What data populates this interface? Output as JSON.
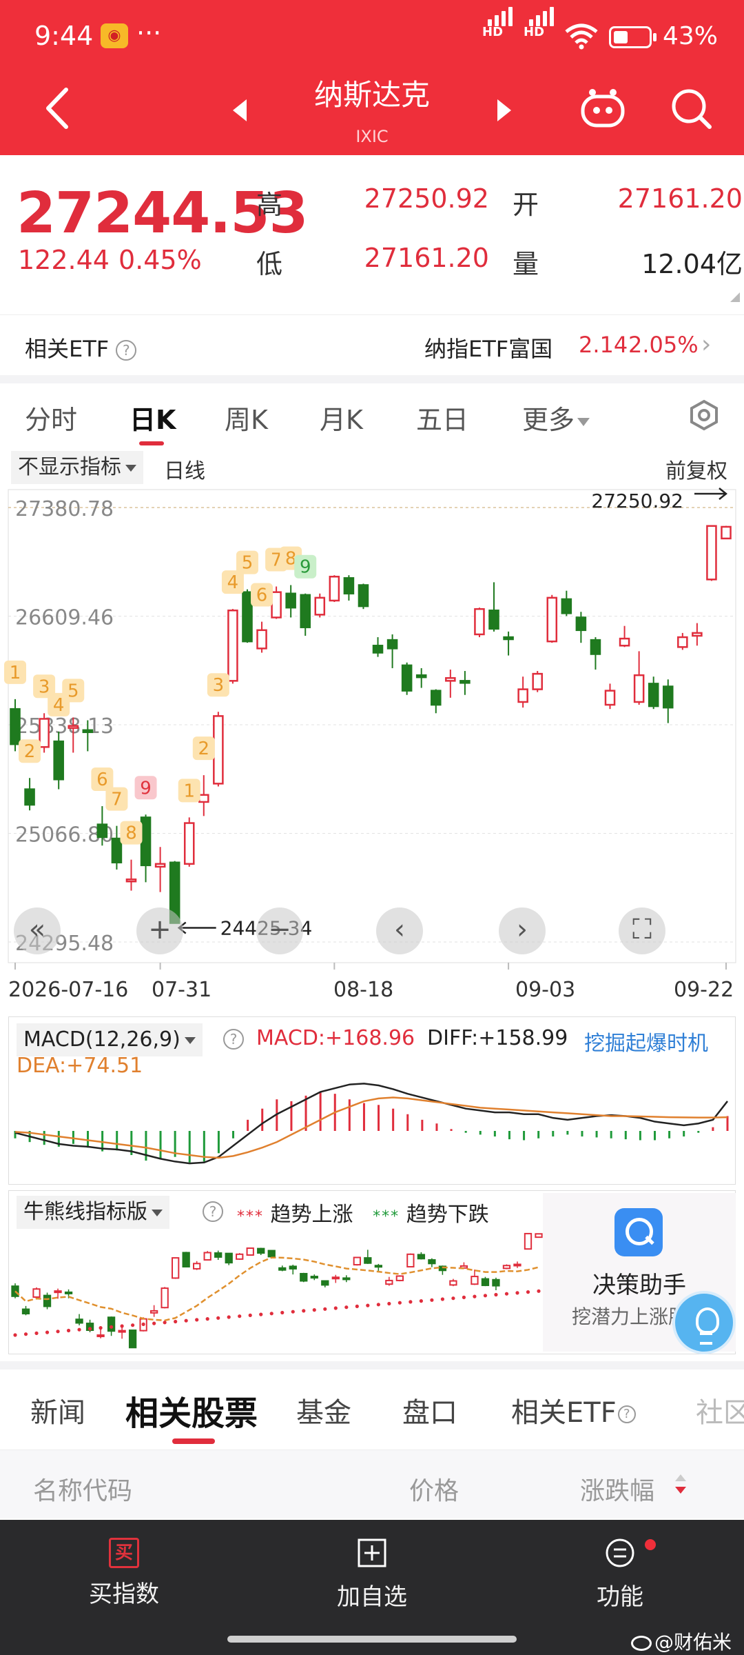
{
  "status": {
    "time": "9:44",
    "signal1": "HD",
    "signal2": "HD",
    "battery": "43%"
  },
  "nav": {
    "title": "纳斯达克",
    "subtitle": "IXIC"
  },
  "quote": {
    "price": "27244.53",
    "change": "122.44",
    "change_pct": "0.45%",
    "high_label": "高",
    "high": "27250.92",
    "open_label": "开",
    "open": "27161.20",
    "low_label": "低",
    "low": "27161.20",
    "volume_label": "量",
    "volume": "12.04亿"
  },
  "etf": {
    "label": "相关ETF",
    "name": "纳指ETF富国",
    "value": "2.14",
    "pct": "2.05%"
  },
  "period_tabs": [
    "分时",
    "日K",
    "周K",
    "月K",
    "五日",
    "更多"
  ],
  "toolbar": {
    "indicator_select": "不显示指标",
    "line_type": "日线",
    "adjust": "前复权"
  },
  "chart_data": {
    "type": "candlestick",
    "title": "",
    "y_ticks": [
      "27380.78",
      "26609.46",
      "25838.13",
      "25066.80",
      "24295.48"
    ],
    "x_ticks": [
      "2026-07-16",
      "07-31",
      "08-18",
      "09-03",
      "09-22"
    ],
    "max_marker": "27250.92",
    "min_marker": "24425.34",
    "candles": [
      {
        "o": 25950,
        "c": 25700,
        "h": 26020,
        "l": 25650
      },
      {
        "o": 25380,
        "c": 25270,
        "h": 25460,
        "l": 25230
      },
      {
        "o": 25680,
        "c": 25880,
        "h": 25920,
        "l": 25640
      },
      {
        "o": 25720,
        "c": 25450,
        "h": 25790,
        "l": 25380
      },
      {
        "o": 25830,
        "c": 25830,
        "h": 25890,
        "l": 25640
      },
      {
        "o": 25800,
        "c": 25790,
        "h": 25870,
        "l": 25650
      },
      {
        "o": 25130,
        "c": 25040,
        "h": 25260,
        "l": 24980
      },
      {
        "o": 25030,
        "c": 24860,
        "h": 25120,
        "l": 24810
      },
      {
        "o": 24740,
        "c": 24740,
        "h": 24880,
        "l": 24660
      },
      {
        "o": 25180,
        "c": 24840,
        "h": 25200,
        "l": 24720
      },
      {
        "o": 24830,
        "c": 24850,
        "h": 24970,
        "l": 24650
      },
      {
        "o": 24860,
        "c": 24430,
        "h": 24870,
        "l": 24425
      },
      {
        "o": 24850,
        "c": 25140,
        "h": 25180,
        "l": 24830
      },
      {
        "o": 25290,
        "c": 25340,
        "h": 25480,
        "l": 25190
      },
      {
        "o": 25420,
        "c": 25900,
        "h": 25930,
        "l": 25400
      },
      {
        "o": 26150,
        "c": 26650,
        "h": 26660,
        "l": 26130
      },
      {
        "o": 26780,
        "c": 26430,
        "h": 26800,
        "l": 26420
      },
      {
        "o": 26380,
        "c": 26510,
        "h": 26570,
        "l": 26350
      },
      {
        "o": 26600,
        "c": 26780,
        "h": 26820,
        "l": 26590
      },
      {
        "o": 26770,
        "c": 26670,
        "h": 26830,
        "l": 26600
      },
      {
        "o": 26760,
        "c": 26530,
        "h": 26770,
        "l": 26470
      },
      {
        "o": 26620,
        "c": 26740,
        "h": 26770,
        "l": 26600
      },
      {
        "o": 26720,
        "c": 26890,
        "h": 26900,
        "l": 26710
      },
      {
        "o": 26880,
        "c": 26770,
        "h": 26900,
        "l": 26720
      },
      {
        "o": 26830,
        "c": 26680,
        "h": 26840,
        "l": 26660
      },
      {
        "o": 26400,
        "c": 26350,
        "h": 26460,
        "l": 26320
      },
      {
        "o": 26440,
        "c": 26380,
        "h": 26480,
        "l": 26240
      },
      {
        "o": 26260,
        "c": 26080,
        "h": 26280,
        "l": 26050
      },
      {
        "o": 26190,
        "c": 26180,
        "h": 26240,
        "l": 26100
      },
      {
        "o": 26080,
        "c": 25980,
        "h": 26090,
        "l": 25920
      },
      {
        "o": 26150,
        "c": 26170,
        "h": 26230,
        "l": 26030
      },
      {
        "o": 26150,
        "c": 26140,
        "h": 26220,
        "l": 26050
      },
      {
        "o": 26480,
        "c": 26660,
        "h": 26670,
        "l": 26460
      },
      {
        "o": 26650,
        "c": 26520,
        "h": 26850,
        "l": 26500
      },
      {
        "o": 26460,
        "c": 26450,
        "h": 26500,
        "l": 26330
      },
      {
        "o": 26000,
        "c": 26090,
        "h": 26180,
        "l": 25960
      },
      {
        "o": 26090,
        "c": 26200,
        "h": 26220,
        "l": 26070
      },
      {
        "o": 26430,
        "c": 26740,
        "h": 26760,
        "l": 26420
      },
      {
        "o": 26730,
        "c": 26630,
        "h": 26790,
        "l": 26610
      },
      {
        "o": 26600,
        "c": 26510,
        "h": 26640,
        "l": 26420
      },
      {
        "o": 26440,
        "c": 26340,
        "h": 26460,
        "l": 26230
      },
      {
        "o": 25980,
        "c": 26080,
        "h": 26130,
        "l": 25950
      },
      {
        "o": 26400,
        "c": 26450,
        "h": 26540,
        "l": 26390
      },
      {
        "o": 26000,
        "c": 26190,
        "h": 26360,
        "l": 25980
      },
      {
        "o": 26130,
        "c": 25970,
        "h": 26180,
        "l": 25950
      },
      {
        "o": 26110,
        "c": 25960,
        "h": 26160,
        "l": 25850
      },
      {
        "o": 26390,
        "c": 26460,
        "h": 26490,
        "l": 26370
      },
      {
        "o": 26470,
        "c": 26490,
        "h": 26560,
        "l": 26400
      },
      {
        "o": 26870,
        "c": 27250,
        "h": 27250,
        "l": 26860
      },
      {
        "o": 27161,
        "c": 27244,
        "h": 27251,
        "l": 27161
      }
    ],
    "markers": [
      {
        "i": 0,
        "t": "1",
        "c": "y"
      },
      {
        "i": 1,
        "t": "2",
        "c": "y"
      },
      {
        "i": 2,
        "t": "3",
        "c": "y"
      },
      {
        "i": 3,
        "t": "4",
        "c": "y"
      },
      {
        "i": 4,
        "t": "5",
        "c": "y"
      },
      {
        "i": 6,
        "t": "6",
        "c": "y"
      },
      {
        "i": 7,
        "t": "7",
        "c": "y"
      },
      {
        "i": 8,
        "t": "8",
        "c": "y"
      },
      {
        "i": 9,
        "t": "9",
        "c": "r"
      },
      {
        "i": 12,
        "t": "1",
        "c": "y"
      },
      {
        "i": 13,
        "t": "2",
        "c": "y"
      },
      {
        "i": 14,
        "t": "3",
        "c": "y"
      },
      {
        "i": 15,
        "t": "4",
        "c": "y"
      },
      {
        "i": 16,
        "t": "5",
        "c": "y"
      },
      {
        "i": 17,
        "t": "6",
        "c": "y"
      },
      {
        "i": 18,
        "t": "7",
        "c": "y"
      },
      {
        "i": 19,
        "t": "8",
        "c": "y"
      },
      {
        "i": 20,
        "t": "9",
        "c": "g"
      }
    ]
  },
  "macd": {
    "select": "MACD(12,26,9)",
    "macd_label": "MACD:+168.96",
    "diff_label": "DIFF:+158.99",
    "dea_label": "DEA:+74.51",
    "promo": "挖掘起爆时机",
    "bars": [
      -40,
      -60,
      -75,
      -85,
      -70,
      -90,
      -110,
      -105,
      -130,
      -160,
      -150,
      -140,
      -170,
      -165,
      -120,
      -40,
      60,
      120,
      170,
      160,
      190,
      210,
      200,
      170,
      150,
      140,
      120,
      90,
      60,
      40,
      10,
      -10,
      -20,
      -30,
      -45,
      -50,
      -40,
      -30,
      -20,
      -30,
      -35,
      -40,
      -45,
      -50,
      -50,
      -40,
      -30,
      -10,
      20,
      80
    ],
    "diff": [
      -10,
      -30,
      -50,
      -70,
      -80,
      -85,
      -95,
      -100,
      -110,
      -130,
      -150,
      -165,
      -175,
      -170,
      -140,
      -80,
      -20,
      40,
      90,
      130,
      170,
      210,
      230,
      250,
      255,
      245,
      225,
      200,
      180,
      160,
      140,
      120,
      110,
      100,
      100,
      90,
      90,
      70,
      60,
      70,
      80,
      85,
      80,
      70,
      50,
      40,
      30,
      40,
      60,
      160
    ],
    "dea": [
      -5,
      -10,
      -20,
      -30,
      -40,
      -50,
      -60,
      -70,
      -80,
      -90,
      -105,
      -120,
      -130,
      -140,
      -145,
      -135,
      -115,
      -90,
      -60,
      -20,
      20,
      60,
      100,
      130,
      160,
      175,
      180,
      175,
      165,
      155,
      145,
      135,
      125,
      120,
      115,
      110,
      105,
      100,
      95,
      90,
      85,
      80,
      80,
      78,
      76,
      74,
      73,
      72,
      72,
      74
    ]
  },
  "bull_bear": {
    "select": "牛熊线指标版",
    "legend_up_dots": "***",
    "legend_up": "趋势上涨",
    "legend_down_dots": "***",
    "legend_down": "趋势下跌"
  },
  "assistant": {
    "title": "决策助手",
    "subtitle": "挖潜力上涨股"
  },
  "bottom_tabs": [
    "新闻",
    "相关股票",
    "基金",
    "盘口",
    "相关ETF",
    "社区"
  ],
  "list_header": {
    "name": "名称代码",
    "price": "价格",
    "change": "涨跌幅"
  },
  "bottom_bar": {
    "buy": "买指数",
    "buy_icon_text": "买",
    "add": "加自选",
    "func": "功能"
  },
  "watermark": "@财佑米",
  "colors": {
    "header": "#ef2f3a",
    "up": "#e02d3c",
    "down": "#1f7a1f",
    "bottom_bar": "#2a2a2c"
  }
}
